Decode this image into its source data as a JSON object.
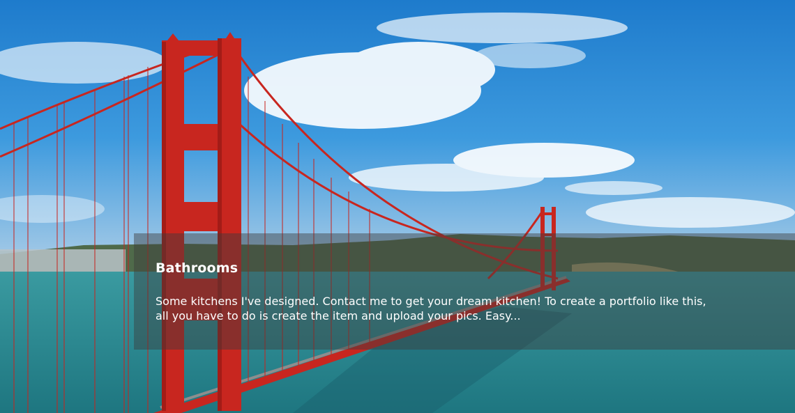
{
  "slide": {
    "image": "golden-gate-bridge-photo",
    "caption": {
      "title": "Bathrooms",
      "text": "Some kitchens I've designed. Contact me to get your dream kitchen! To create a portfolio like this, all you have to do is create the item and upload your pics. Easy..."
    }
  },
  "colors": {
    "sky": "#2a8ad6",
    "water": "#2a8890",
    "bridge": "#c8261f",
    "caption_overlay": "rgba(60,60,60,0.45)",
    "caption_text": "#ffffff"
  }
}
